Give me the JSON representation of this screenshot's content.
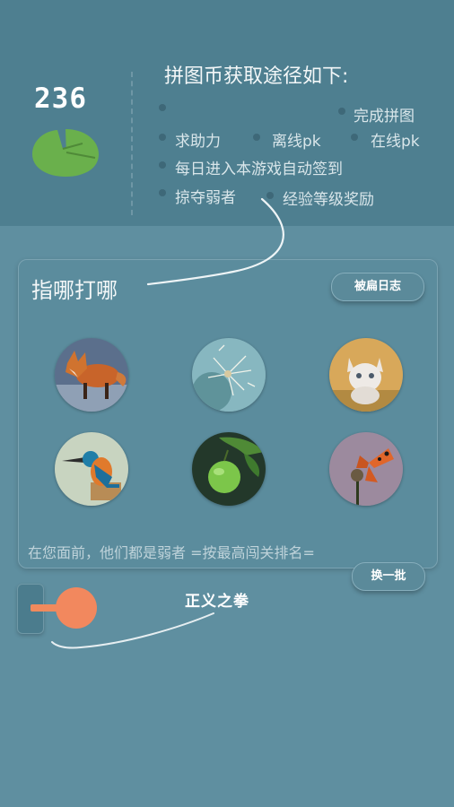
{
  "header": {
    "coin_count": "236",
    "ways_title": "拼图币获取途径如下:",
    "ways": [
      {
        "label": ""
      },
      {
        "label": "完成拼图"
      },
      {
        "label": "求助力"
      },
      {
        "label": "离线pk"
      },
      {
        "label": "在线pk"
      },
      {
        "label": "每日进入本游戏自动签到"
      },
      {
        "label": "掠夺弱者"
      },
      {
        "label": "经验等级奖励"
      }
    ]
  },
  "panel": {
    "title": "指哪打哪",
    "log_button": "被扁日志",
    "refresh_button": "换一批",
    "footer": "在您面前，他们都是弱者 =按最高闯关排名=",
    "opponents": [
      {
        "icon": "fox-avatar"
      },
      {
        "icon": "dandelion-avatar"
      },
      {
        "icon": "kitten-avatar"
      },
      {
        "icon": "kingfisher-avatar"
      },
      {
        "icon": "apple-avatar"
      },
      {
        "icon": "butterfly-avatar"
      }
    ]
  },
  "bottom": {
    "punch_label": "正义之拳"
  },
  "colors": {
    "background": "#5f8fa0",
    "header": "#4e7f90",
    "accent": "#f2885e",
    "leaf": "#6ab04c"
  }
}
